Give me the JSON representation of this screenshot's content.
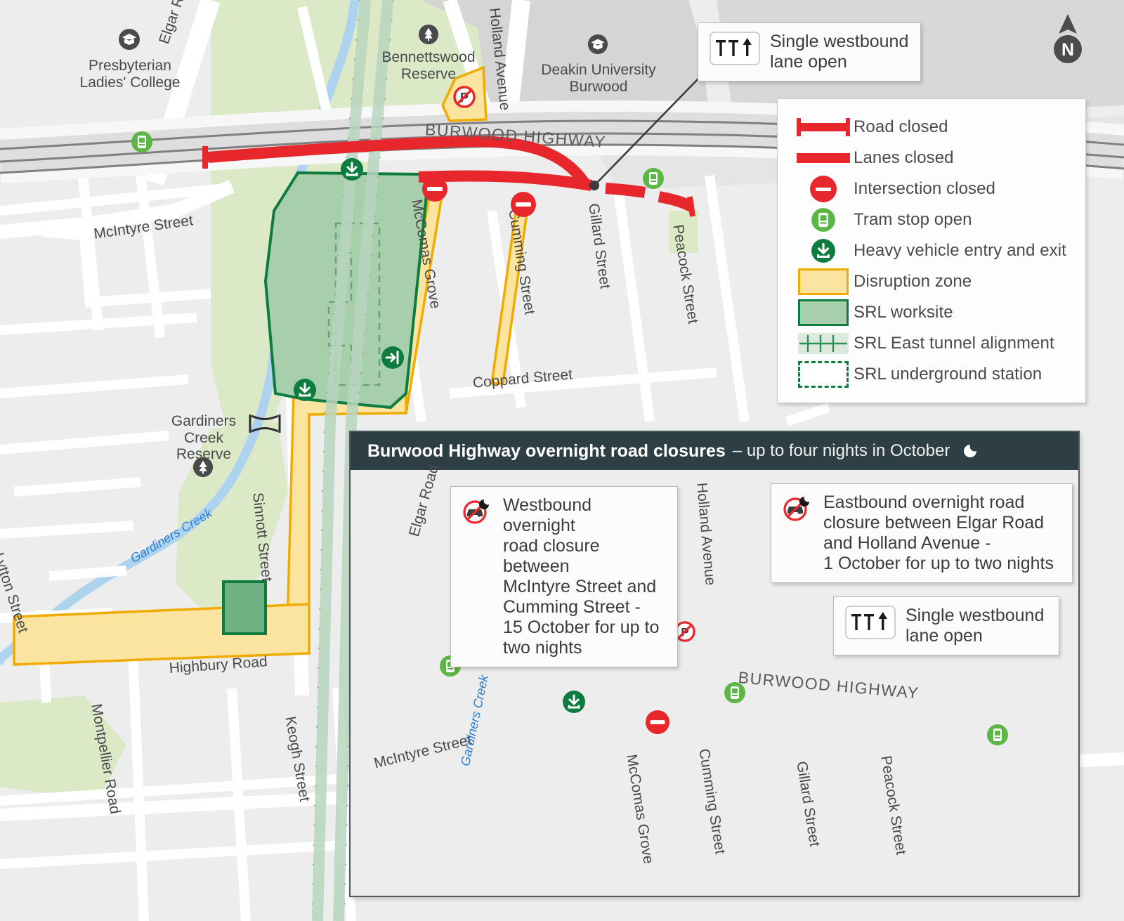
{
  "title": "Burwood Highway overnight road closures map",
  "colors": {
    "road_closed_red": "#e8272c",
    "lanes_closed_red": "#e8272c",
    "disruption_zone_fill": "#fbe3a0",
    "disruption_zone_border": "#f0ab00",
    "srl_worksite_fill": "#a8cfac",
    "srl_worksite_border": "#0d7c3e",
    "tram_stop_green": "#5cb646",
    "heavy_vehicle_green": "#0d7c3e",
    "panel_header_dark": "#2d3e45",
    "park_green": "#d9e8c4",
    "water_blue": "#aed3ef",
    "building_grey": "#d3d3d3",
    "base_grey": "#ededed"
  },
  "north_arrow": {
    "label": "N",
    "icon": "north-arrow-icon"
  },
  "legend": {
    "items": [
      {
        "key": "road-closed",
        "label": "Road closed"
      },
      {
        "key": "lanes-closed",
        "label": "Lanes closed"
      },
      {
        "key": "intersection-closed",
        "label": "Intersection closed"
      },
      {
        "key": "tram-stop-open",
        "label": "Tram stop open"
      },
      {
        "key": "heavy-vehicle-entry-exit",
        "label": "Heavy vehicle entry and exit"
      },
      {
        "key": "disruption-zone",
        "label": "Disruption zone"
      },
      {
        "key": "srl-worksite",
        "label": "SRL worksite"
      },
      {
        "key": "srl-tunnel-alignment",
        "label": "SRL East tunnel alignment"
      },
      {
        "key": "srl-underground-station",
        "label": "SRL underground station"
      }
    ]
  },
  "callouts": {
    "main_lane_open": {
      "text": "Single westbound\nlane open",
      "icon": "single-lane-open-icon"
    },
    "inset_lane_open": {
      "text": "Single westbound\nlane open",
      "icon": "single-lane-open-icon"
    },
    "westbound_closure": {
      "icon": "no-cars-night-icon",
      "text": "Westbound overnight\nroad closure between\nMcIntyre Street and\nCumming Street -\n15 October for up to\ntwo nights"
    },
    "eastbound_closure": {
      "icon": "no-cars-night-icon",
      "text": "Eastbound overnight road\nclosure between Elgar Road\nand Holland Avenue -\n1 October for up to two nights"
    }
  },
  "inset": {
    "header_title": "Burwood Highway overnight road closures",
    "header_subtitle": "– up to four nights in October",
    "moon_icon": "moon-icon"
  },
  "main_map": {
    "places": [
      {
        "name": "presbyterian-ladies-college",
        "label": "Presbyterian\nLadies' College",
        "icon": "school-icon"
      },
      {
        "name": "bennettswood-reserve",
        "label": "Bennettswood\nReserve",
        "icon": "park-tree-icon"
      },
      {
        "name": "deakin-university-burwood",
        "label": "Deakin University\nBurwood",
        "icon": "school-icon"
      },
      {
        "name": "gardiners-creek-reserve",
        "label": "Gardiners\nCreek\nReserve",
        "icon": "park-tree-icon"
      }
    ],
    "streets": [
      {
        "name": "elgar-road",
        "label": "Elgar Road"
      },
      {
        "name": "holland-avenue",
        "label": "Holland Avenue"
      },
      {
        "name": "burwood-highway",
        "label": "BURWOOD HIGHWAY"
      },
      {
        "name": "mcintyre-street",
        "label": "McIntyre Street"
      },
      {
        "name": "mccomas-grove",
        "label": "McComas Grove"
      },
      {
        "name": "cumming-street",
        "label": "Cumming Street"
      },
      {
        "name": "gillard-street",
        "label": "Gillard Street"
      },
      {
        "name": "peacock-street",
        "label": "Peacock Street"
      },
      {
        "name": "coppard-street",
        "label": "Coppard Street"
      },
      {
        "name": "sinnott-street",
        "label": "Sinnott Street"
      },
      {
        "name": "lytton-street",
        "label": "Lytton Street"
      },
      {
        "name": "highbury-road",
        "label": "Highbury Road"
      },
      {
        "name": "montpellier-road",
        "label": "Montpellier Road"
      },
      {
        "name": "keogh-street",
        "label": "Keogh Street"
      },
      {
        "name": "gardiners-creek",
        "label": "Gardiners Creek"
      }
    ],
    "markers": [
      {
        "name": "tram-stop-elgar",
        "type": "tram-stop-open"
      },
      {
        "name": "tram-stop-gillard",
        "type": "tram-stop-open"
      },
      {
        "name": "intersection-closed-mccomas",
        "type": "intersection-closed"
      },
      {
        "name": "intersection-closed-cumming",
        "type": "intersection-closed"
      },
      {
        "name": "heavy-vehicle-north",
        "type": "heavy-vehicle-entry-exit"
      },
      {
        "name": "heavy-vehicle-south",
        "type": "heavy-vehicle-entry-exit"
      },
      {
        "name": "heavy-vehicle-exit-east",
        "type": "heavy-vehicle-exit"
      },
      {
        "name": "no-parking-holland",
        "type": "no-parking"
      }
    ]
  },
  "inset_map": {
    "streets": [
      {
        "name": "elgar-road",
        "label": "Elgar Road"
      },
      {
        "name": "holland-avenue",
        "label": "Holland Avenue"
      },
      {
        "name": "burwood-highway",
        "label": "BURWOOD HIGHWAY"
      },
      {
        "name": "mcintyre-street",
        "label": "McIntyre Street"
      },
      {
        "name": "mccomas-grove",
        "label": "McComas Grove"
      },
      {
        "name": "cumming-street",
        "label": "Cumming Street"
      },
      {
        "name": "gillard-street",
        "label": "Gillard Street"
      },
      {
        "name": "peacock-street",
        "label": "Peacock Street"
      },
      {
        "name": "gardiners-creek",
        "label": "Gardiners Creek"
      }
    ],
    "markers": [
      {
        "name": "tram-stop-west",
        "type": "tram-stop-open"
      },
      {
        "name": "tram-stop-east",
        "type": "tram-stop-open"
      },
      {
        "name": "tram-stop-far-east",
        "type": "tram-stop-open"
      },
      {
        "name": "intersection-closed-mccomas",
        "type": "intersection-closed"
      },
      {
        "name": "heavy-vehicle-entry",
        "type": "heavy-vehicle-entry-exit"
      },
      {
        "name": "no-parking-holland",
        "type": "no-parking"
      }
    ]
  }
}
